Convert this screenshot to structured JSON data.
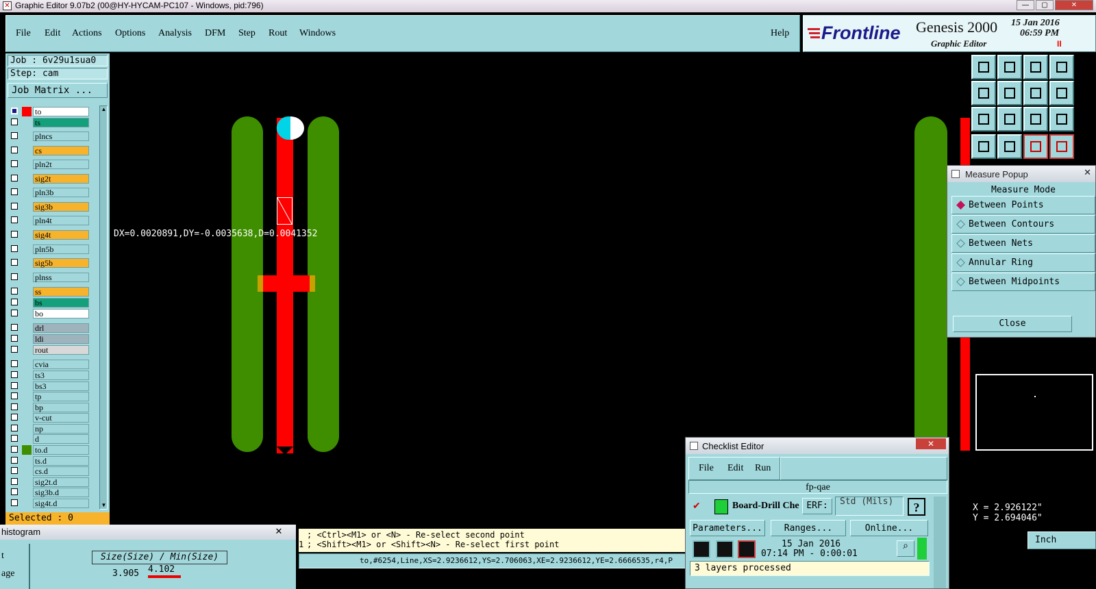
{
  "window": {
    "title": "Graphic Editor 9.07b2 (00@HY-HYCAM-PC107 - Windows, pid:796)",
    "controls": [
      "—",
      "▢",
      "✕"
    ]
  },
  "menubar": {
    "items": [
      "File",
      "Edit",
      "Actions",
      "Options",
      "Analysis",
      "DFM",
      "Step",
      "Rout",
      "Windows"
    ],
    "help": "Help"
  },
  "brand": {
    "logo": "Frontline",
    "product": "Genesis 2000",
    "subtitle": "Graphic Editor",
    "date": "15 Jan 2016",
    "time": "06:59 PM",
    "pause": "II"
  },
  "left_panel": {
    "job": "Job : 6v29u1sua0",
    "step": "Step: cam",
    "job_matrix": "Job Matrix ...",
    "selected": "Selected : 0",
    "layers": [
      {
        "name": "to",
        "color": "#ffffff",
        "checked": true
      },
      {
        "name": "ts",
        "color": "#14a07a",
        "checked": false
      },
      {
        "name": "plncs",
        "color": "#a2d8dc",
        "checked": false
      },
      {
        "name": "cs",
        "color": "#f7b32b",
        "checked": false
      },
      {
        "name": "pln2t",
        "color": "#a2d8dc",
        "checked": false
      },
      {
        "name": "sig2t",
        "color": "#f7b32b",
        "checked": false
      },
      {
        "name": "pln3b",
        "color": "#a2d8dc",
        "checked": false
      },
      {
        "name": "sig3b",
        "color": "#f7b32b",
        "checked": false
      },
      {
        "name": "pln4t",
        "color": "#a2d8dc",
        "checked": false
      },
      {
        "name": "sig4t",
        "color": "#f7b32b",
        "checked": false
      },
      {
        "name": "pln5b",
        "color": "#a2d8dc",
        "checked": false
      },
      {
        "name": "sig5b",
        "color": "#f7b32b",
        "checked": false
      },
      {
        "name": "plnss",
        "color": "#a2d8dc",
        "checked": false
      },
      {
        "name": "ss",
        "color": "#f7b32b",
        "checked": false
      },
      {
        "name": "bs",
        "color": "#14a07a",
        "checked": false
      },
      {
        "name": "bo",
        "color": "#ffffff",
        "checked": false
      },
      {
        "name": "drl",
        "color": "#9fb3bd",
        "checked": false
      },
      {
        "name": "ldi",
        "color": "#9fb3bd",
        "checked": false
      },
      {
        "name": "rout",
        "color": "#d8d8d8",
        "checked": false
      },
      {
        "name": "cvia",
        "color": "#a2d8dc",
        "checked": false
      },
      {
        "name": "ts3",
        "color": "#a2d8dc",
        "checked": false
      },
      {
        "name": "bs3",
        "color": "#a2d8dc",
        "checked": false
      },
      {
        "name": "tp",
        "color": "#a2d8dc",
        "checked": false
      },
      {
        "name": "bp",
        "color": "#a2d8dc",
        "checked": false
      },
      {
        "name": "v-cut",
        "color": "#a2d8dc",
        "checked": false
      },
      {
        "name": "np",
        "color": "#a2d8dc",
        "checked": false
      },
      {
        "name": "d",
        "color": "#a2d8dc",
        "checked": false
      },
      {
        "name": "to.d",
        "color": "#a2d8dc",
        "checked": false
      },
      {
        "name": "ts.d",
        "color": "#a2d8dc",
        "checked": false
      },
      {
        "name": "cs.d",
        "color": "#a2d8dc",
        "checked": false
      },
      {
        "name": "sig2t.d",
        "color": "#a2d8dc",
        "checked": false
      },
      {
        "name": "sig3b.d",
        "color": "#a2d8dc",
        "checked": false
      },
      {
        "name": "sig4t.d",
        "color": "#a2d8dc",
        "checked": false
      }
    ]
  },
  "canvas": {
    "measure_readout": "DX=0.0020891,DY=-0.0035638,D=0.0041352"
  },
  "measure_popup": {
    "title": "Measure Popup",
    "heading": "Measure Mode",
    "options": [
      "Between Points",
      "Between Contours",
      "Between Nets",
      "Annular Ring",
      "Between Midpoints"
    ],
    "selected_index": 0,
    "close": "Close"
  },
  "coords": {
    "x": "X = 2.926122\"",
    "y": "Y = 2.694046\"",
    "unit": "Inch"
  },
  "histogram": {
    "title": "histogram",
    "label_t": "t",
    "label_age": "age",
    "axis_title": "Size(Size) / Min(Size)",
    "value1": "3.905",
    "value2": "4.102"
  },
  "prompt": {
    "line1": "; <Ctrl><M1> or <N> - Re-select second point",
    "line1_prefix": "",
    "line2": "; <Shift><M1> or <Shift><N> - Re-select first point",
    "line2_prefix": "1",
    "status": "to,#6254,Line,XS=2.9236612,YS=2.706063,XE=2.9236612,YE=2.6666535,r4,P"
  },
  "checklist": {
    "title": "Checklist Editor",
    "menu": [
      "File",
      "Edit",
      "Run"
    ],
    "name": "fp-qae",
    "check_label": "Board-Drill Che",
    "erf_label": "ERF:",
    "erf_value": "Std (Mils)",
    "help": "?",
    "buttons": [
      "Parameters...",
      "Ranges...",
      "Online..."
    ],
    "date": "15 Jan 2016",
    "time": "07:14 PM - 0:00:01",
    "status": "3 layers processed"
  }
}
